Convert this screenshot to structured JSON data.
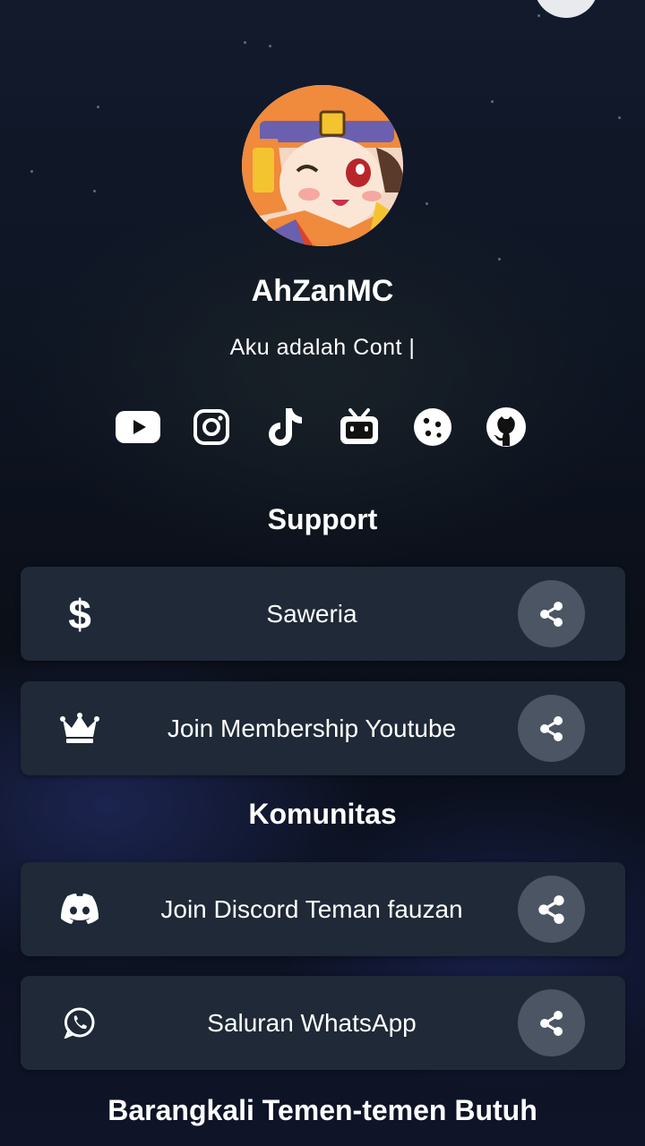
{
  "profile": {
    "name": "AhZanMC",
    "bio": "Aku adalah Cont |"
  },
  "socials": [
    {
      "name": "youtube-icon"
    },
    {
      "name": "instagram-icon"
    },
    {
      "name": "tiktok-icon"
    },
    {
      "name": "bilibili-icon"
    },
    {
      "name": "cookie-icon"
    },
    {
      "name": "github-icon"
    }
  ],
  "sections": {
    "support": {
      "title": "Support",
      "links": [
        {
          "label": "Saweria",
          "icon": "dollar-icon"
        },
        {
          "label": "Join Membership Youtube",
          "icon": "crown-icon"
        }
      ]
    },
    "komunitas": {
      "title": "Komunitas",
      "links": [
        {
          "label": "Join Discord Teman fauzan",
          "icon": "discord-icon"
        },
        {
          "label": "Saluran WhatsApp",
          "icon": "whatsapp-icon"
        }
      ]
    },
    "extra": {
      "title": "Barangkali Temen-temen Butuh"
    }
  },
  "colors": {
    "card": "#1f2937",
    "share_button": "#4b5563",
    "text": "#ffffff"
  }
}
